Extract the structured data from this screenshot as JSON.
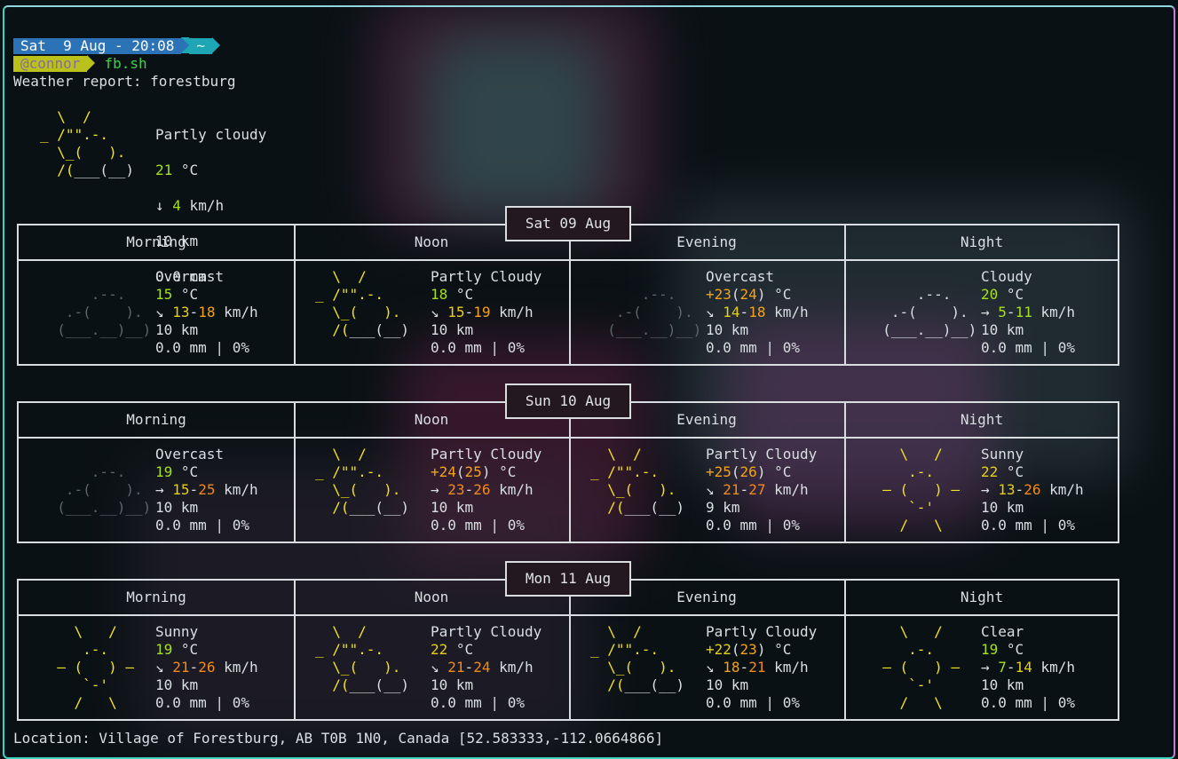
{
  "prompt": {
    "date": "Sat  9 Aug - 20:08",
    "dir": "~",
    "user": "@connor",
    "command": "fb.sh"
  },
  "title": "Weather report: forestburg",
  "current": {
    "condition": "Partly cloudy",
    "temp": "21",
    "temp_unit": " °C",
    "wind_dir": "↓",
    "wind": "4",
    "wind_unit": " km/h",
    "visibility": "10 km",
    "precip": "0.0 mm"
  },
  "periods": [
    "Morning",
    "Noon",
    "Evening",
    "Night"
  ],
  "days": [
    {
      "label": "Sat 09 Aug",
      "cells": [
        {
          "icon": "overcast-icon",
          "condition": "Overcast",
          "temp": "15",
          "temp_extra": "",
          "wind_dir": "↘",
          "wind_lo": "13",
          "wind_hi": "18",
          "vis": "10 km",
          "precip": "0.0 mm | 0%"
        },
        {
          "icon": "partly-cloudy-icon",
          "condition": "Partly Cloudy",
          "temp": "18",
          "temp_extra": "",
          "wind_dir": "↘",
          "wind_lo": "15",
          "wind_hi": "19",
          "vis": "10 km",
          "precip": "0.0 mm | 0%"
        },
        {
          "icon": "overcast-icon",
          "condition": "Overcast",
          "temp": "+23",
          "temp_extra": "24",
          "wind_dir": "↘",
          "wind_lo": "14",
          "wind_hi": "18",
          "vis": "10 km",
          "precip": "0.0 mm | 0%"
        },
        {
          "icon": "cloudy-icon",
          "condition": "Cloudy",
          "temp": "20",
          "temp_extra": "",
          "wind_dir": "→",
          "wind_lo": "5",
          "wind_hi": "11",
          "vis": "10 km",
          "precip": "0.0 mm | 0%"
        }
      ]
    },
    {
      "label": "Sun 10 Aug",
      "cells": [
        {
          "icon": "overcast-icon",
          "condition": "Overcast",
          "temp": "19",
          "temp_extra": "",
          "wind_dir": "→",
          "wind_lo": "15",
          "wind_hi": "25",
          "vis": "10 km",
          "precip": "0.0 mm | 0%"
        },
        {
          "icon": "partly-cloudy-icon",
          "condition": "Partly Cloudy",
          "temp": "+24",
          "temp_extra": "25",
          "wind_dir": "→",
          "wind_lo": "23",
          "wind_hi": "26",
          "vis": "10 km",
          "precip": "0.0 mm | 0%"
        },
        {
          "icon": "partly-cloudy-icon",
          "condition": "Partly Cloudy",
          "temp": "+25",
          "temp_extra": "26",
          "wind_dir": "↘",
          "wind_lo": "21",
          "wind_hi": "27",
          "vis": "9 km",
          "precip": "0.0 mm | 0%"
        },
        {
          "icon": "sunny-icon",
          "condition": "Sunny",
          "temp": "22",
          "temp_extra": "",
          "wind_dir": "→",
          "wind_lo": "13",
          "wind_hi": "26",
          "vis": "10 km",
          "precip": "0.0 mm | 0%"
        }
      ]
    },
    {
      "label": "Mon 11 Aug",
      "cells": [
        {
          "icon": "sunny-icon",
          "condition": "Sunny",
          "temp": "19",
          "temp_extra": "",
          "wind_dir": "↘",
          "wind_lo": "21",
          "wind_hi": "26",
          "vis": "10 km",
          "precip": "0.0 mm | 0%"
        },
        {
          "icon": "partly-cloudy-icon",
          "condition": "Partly Cloudy",
          "temp": "22",
          "temp_extra": "",
          "wind_dir": "↘",
          "wind_lo": "21",
          "wind_hi": "24",
          "vis": "10 km",
          "precip": "0.0 mm | 0%"
        },
        {
          "icon": "partly-cloudy-icon",
          "condition": "Partly Cloudy",
          "temp": "+22",
          "temp_extra": "23",
          "wind_dir": "↘",
          "wind_lo": "18",
          "wind_hi": "21",
          "vis": "10 km",
          "precip": "0.0 mm | 0%"
        },
        {
          "icon": "clear-icon",
          "condition": "Clear",
          "temp": "19",
          "temp_extra": "",
          "wind_dir": "→",
          "wind_lo": "7",
          "wind_hi": "14",
          "vis": "10 km",
          "precip": "0.0 mm | 0%"
        }
      ]
    }
  ],
  "units": {
    "temp": " °C",
    "wind": " km/h"
  },
  "footer": "Location: Village of Forestburg, AB T0B 1N0, Canada [52.583333,-112.0664866]",
  "colors": {
    "cyan_border": "#3dd3c4",
    "yellow": "#f2e21f",
    "green": "#a4e01c",
    "orange": "#f2a31a"
  }
}
